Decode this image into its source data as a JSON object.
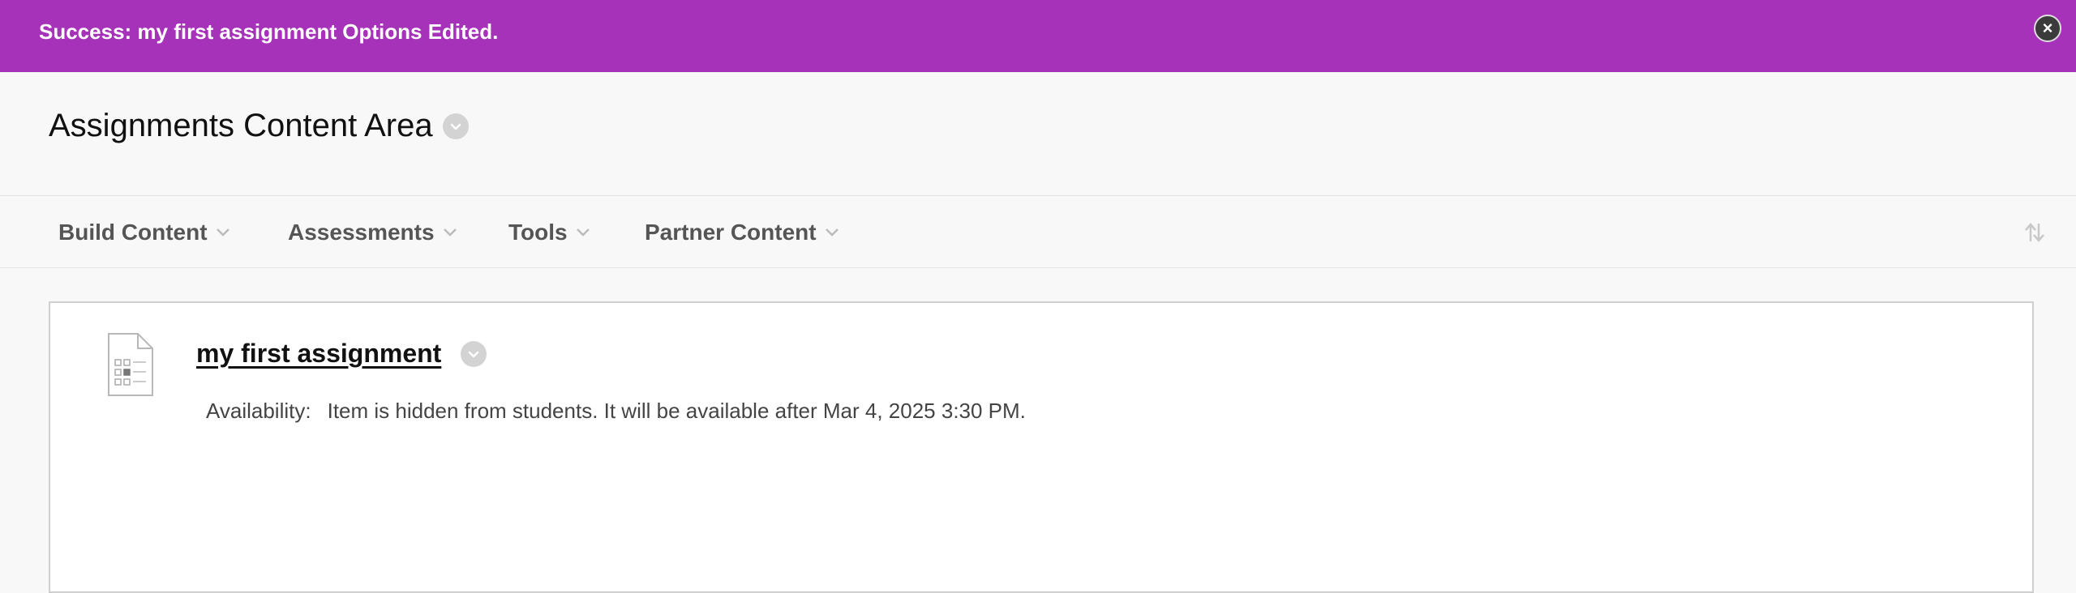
{
  "banner": {
    "message": "Success: my first assignment Options Edited.",
    "close_icon": "close-icon",
    "color": "#a532b8"
  },
  "header": {
    "title": "Assignments Content Area",
    "menu_icon": "chevron-down-icon"
  },
  "action_bar": {
    "menus": [
      {
        "label": "Build Content"
      },
      {
        "label": "Assessments"
      },
      {
        "label": "Tools"
      },
      {
        "label": "Partner Content"
      }
    ],
    "sort_icon": "sort-arrows-icon"
  },
  "content": {
    "items": [
      {
        "title": "my first assignment",
        "icon": "assignment-document-icon",
        "availability_label": "Availability:",
        "availability_text": "Item is hidden from students. It will be available after Mar 4, 2025 3:30 PM."
      }
    ]
  }
}
